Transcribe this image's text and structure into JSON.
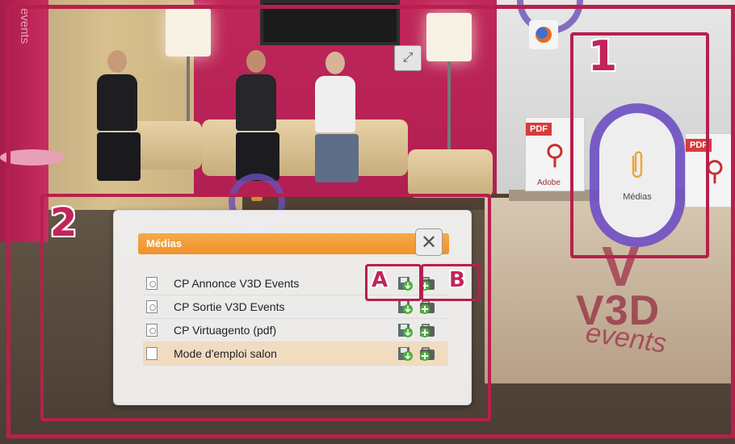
{
  "scene": {
    "side_text": "events",
    "pdf_tag": "PDF",
    "pdf_brand": "Adobe",
    "logo": {
      "mark": "V",
      "name": "V3D",
      "tagline": "events"
    }
  },
  "medias_button": {
    "label": "Médias",
    "icon": "paperclip-icon"
  },
  "annotations": {
    "one": "1",
    "two": "2",
    "a": "A",
    "b": "B"
  },
  "dialog": {
    "title": "Médias",
    "close_label": "✕",
    "items": [
      {
        "label": "CP Annonce V3D Events",
        "type": "pdf",
        "highlighted": false
      },
      {
        "label": "CP Sortie V3D Events",
        "type": "pdf",
        "highlighted": false
      },
      {
        "label": "CP Virtuagento (pdf)",
        "type": "pdf",
        "highlighted": false
      },
      {
        "label": "Mode d'emploi salon",
        "type": "doc",
        "highlighted": true
      }
    ],
    "actions": {
      "save": "save-download-icon",
      "add": "add-to-briefcase-icon"
    }
  },
  "colors": {
    "accent_orange": "#f0922a",
    "annotation_red": "#b81f4c",
    "halo_purple": "#6e4fc4",
    "row_highlight": "#f2dcc0"
  }
}
